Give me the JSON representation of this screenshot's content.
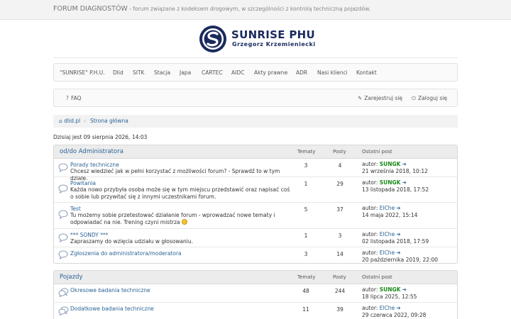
{
  "header": {
    "site_title": "FORUM DIAGNOSTÓW",
    "site_desc": " - forum związane z kodeksem drogowym, w szczególności z kontrolą techniczną pojazdów."
  },
  "logo": {
    "line1": "SUNRISE PHU",
    "line2": "Grzegorz Krzemieniecki",
    "color": "#1a2a5e"
  },
  "nav": [
    "\"SUNRISE\" P.H.U.",
    "Dlid",
    "SITK",
    "Stacja",
    "Japa",
    "CARTEC",
    "AIDC",
    "Akty prawne",
    "ADR",
    "Nasi klienci",
    "Kontakt"
  ],
  "subbar": {
    "faq": "FAQ",
    "register": "Zarejestruj się",
    "login": "Zaloguj się"
  },
  "breadcrumb": {
    "home": "dlid.pl",
    "sep": "‹",
    "current": "Strona główna"
  },
  "date_line": "Dzisiaj jest 09 sierpnia 2026, 14:03",
  "columns": {
    "topics": "Tematy",
    "posts": "Posty",
    "last": "Ostatni post"
  },
  "author_prefix": "autor: ",
  "categories": [
    {
      "title": "od/do Administratora",
      "forums": [
        {
          "name": "Porady techniczne",
          "desc": "Chcesz wiedzieć jak w pełni korzystać z możliwości forum? - Sprawdź to w tym dziale.",
          "topics": "3",
          "posts": "4",
          "author": "SUNGK",
          "author_style": "green",
          "date": "21 września 2018, 10:12"
        },
        {
          "name": "Powitania",
          "desc": "Każda nowo przybyła osoba może się w tym miejscu przedstawić oraz napisać coś o sobie lub przywitać się z innymi uczestnikami forum.",
          "topics": "1",
          "posts": "29",
          "author": "SUNGK",
          "author_style": "green",
          "date": "13 listopada 2018, 17:52"
        },
        {
          "name": "Test",
          "desc": "Tu możemy sobie przetestować działanie forum - wprowadzać nowe tematy i odpowiadać na nie. Trening czyni mistrza",
          "smile": true,
          "topics": "5",
          "posts": "37",
          "author": "ElChe",
          "author_style": "blue",
          "date": "14 maja 2022, 15:14"
        },
        {
          "name": "*** SONDY ***",
          "desc": "Zapraszamy do wzięcia udziału w głosowaniu.",
          "topics": "1",
          "posts": "3",
          "author": "ElChe",
          "author_style": "blue",
          "date": "02 listopada 2018, 17:59"
        },
        {
          "name": "Zgłoszenia do administratora/moderatora",
          "desc": "",
          "topics": "3",
          "posts": "14",
          "author": "ElChe",
          "author_style": "blue",
          "date": "20 października 2019, 22:00"
        }
      ]
    },
    {
      "title": "Pojazdy",
      "forums": [
        {
          "name": "Okresowe badania techniczne",
          "desc": "",
          "topics": "48",
          "posts": "244",
          "author": "SUNGK",
          "author_style": "green",
          "date": "18 lipca 2025, 12:55"
        },
        {
          "name": "Dodatkowe badania techniczne",
          "desc": "",
          "topics": "11",
          "posts": "39",
          "author": "ElChe",
          "author_style": "blue",
          "date": "29 czerwca 2022, 09:28"
        }
      ]
    }
  ]
}
